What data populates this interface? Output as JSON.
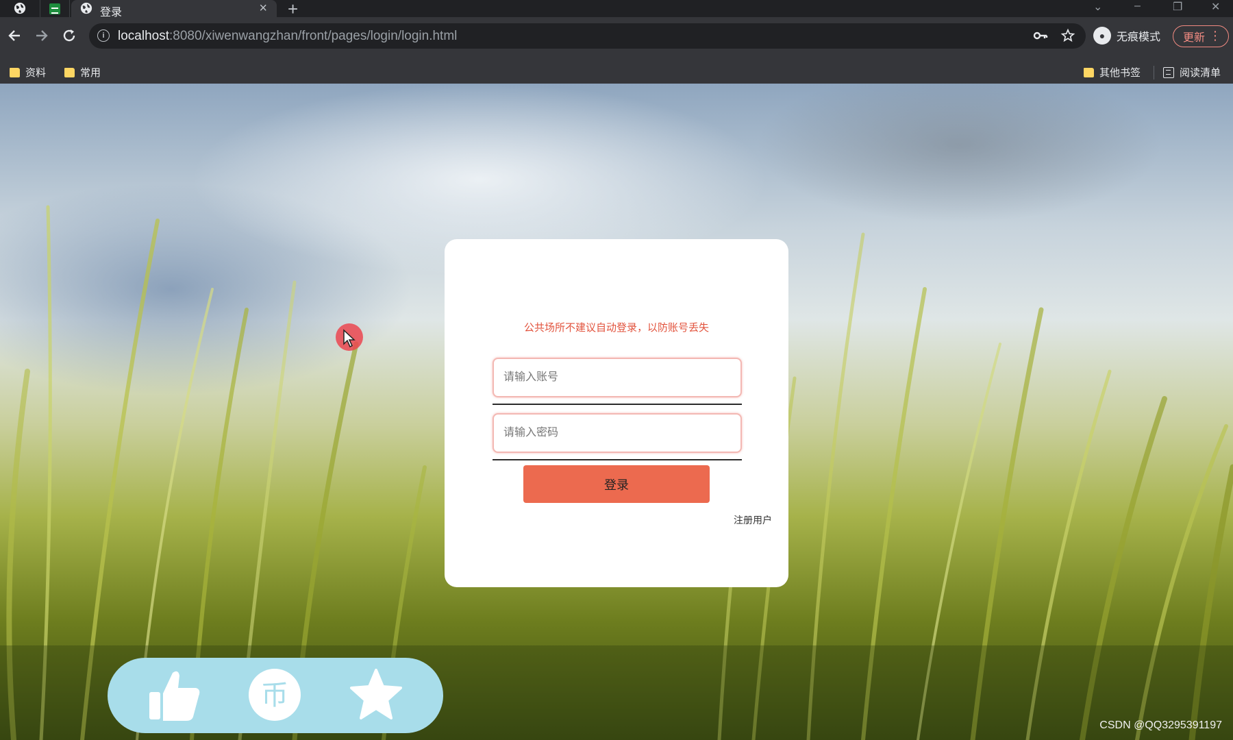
{
  "browser": {
    "tab_title": "登录",
    "close_glyph": "×",
    "newtab_glyph": "+",
    "url_host": "localhost",
    "url_rest": ":8080/xiwenwangzhan/front/pages/login/login.html",
    "incognito_label": "无痕模式",
    "update_label": "更新",
    "bookmarks": [
      {
        "label": "资料"
      },
      {
        "label": "常用"
      }
    ],
    "other_bookmarks_label": "其他书签",
    "reading_list_label": "阅读清单"
  },
  "login": {
    "notice": "公共场所不建议自动登录，以防账号丢失",
    "account_placeholder": "请输入账号",
    "password_placeholder": "请输入密码",
    "submit_label": "登录",
    "register_label": "注册用户"
  },
  "action_bar": {
    "icons": [
      "thumbs-up-icon",
      "coin-icon",
      "star-icon"
    ],
    "coin_glyph": "币"
  },
  "watermark": "CSDN @QQ3295391197",
  "colors": {
    "accent": "#ec6a4f",
    "notice": "#e2533d",
    "action_bar_bg": "#a8ddea"
  }
}
